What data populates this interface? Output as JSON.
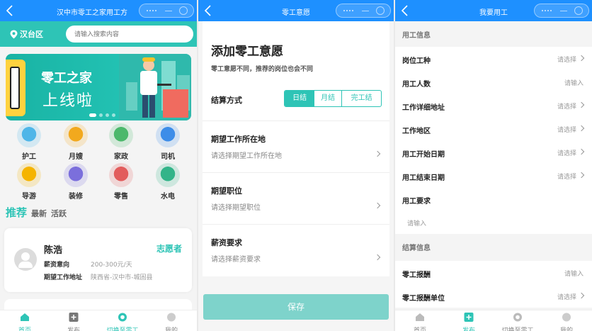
{
  "panel1": {
    "title": "汉中市零工之家用工方",
    "location": "汉台区",
    "search_placeholder": "请输入搜索内容",
    "banner": {
      "line1": "零工之家",
      "line2": "上线啦"
    },
    "categories": [
      {
        "label": "护工",
        "icon": "nurse-icon",
        "color": "#4fb6e8"
      },
      {
        "label": "月嫂",
        "icon": "nanny-icon",
        "color": "#f2a91e"
      },
      {
        "label": "家政",
        "icon": "housekeeping-icon",
        "color": "#4cb86c"
      },
      {
        "label": "司机",
        "icon": "car-icon",
        "color": "#3d8de8"
      },
      {
        "label": "导游",
        "icon": "guide-icon",
        "color": "#f5b400"
      },
      {
        "label": "装修",
        "icon": "paint-roller-icon",
        "color": "#7b6fdc"
      },
      {
        "label": "零售",
        "icon": "retail-icon",
        "color": "#e25c5c"
      },
      {
        "label": "水电",
        "icon": "faucet-icon",
        "color": "#33b489"
      }
    ],
    "tabs": [
      "推荐",
      "最新",
      "活跃"
    ],
    "card": {
      "name": "陈浩",
      "badge": "志愿者",
      "salary_label": "薪资意向",
      "salary_value": "200-300元/天",
      "address_label": "期望工作地址",
      "address_value": "陕西省-汉中市-城固县"
    }
  },
  "panel2": {
    "title": "零工意愿",
    "heading": "添加零工意愿",
    "subheading": "零工意愿不同，推荐的岗位也会不同",
    "settle_label": "结算方式",
    "settle_options": [
      "日结",
      "月结",
      "完工结"
    ],
    "location_label": "期望工作所在地",
    "location_placeholder": "请选择期望工作所在地",
    "position_label": "期望职位",
    "position_placeholder": "请选择期望职位",
    "salary_label": "薪资要求",
    "salary_placeholder": "请选择薪资要求",
    "save": "保存"
  },
  "panel3": {
    "title": "我要用工",
    "section1": "用工信息",
    "rows": [
      {
        "label": "岗位工种",
        "value": "请选择",
        "chevron": true
      },
      {
        "label": "用工人数",
        "value": "请输入",
        "chevron": false
      },
      {
        "label": "工作详细地址",
        "value": "请选择",
        "chevron": true
      },
      {
        "label": "工作地区",
        "value": "请选择",
        "chevron": true
      },
      {
        "label": "用工开始日期",
        "value": "请选择",
        "chevron": true
      },
      {
        "label": "用工结束日期",
        "value": "请选择",
        "chevron": true
      },
      {
        "label": "用工要求",
        "value": "",
        "chevron": false
      }
    ],
    "requirement_placeholder": "请输入",
    "section2": "结算信息",
    "rows2": [
      {
        "label": "零工报酬",
        "value": "请输入",
        "chevron": false
      },
      {
        "label": "零工报酬单位",
        "value": "请选择",
        "chevron": true
      }
    ]
  },
  "tabbar": [
    "首页",
    "发布",
    "切换至零工",
    "我的"
  ],
  "colors": {
    "brand_blue": "#1e90ff",
    "teal": "#2ec4b6"
  }
}
